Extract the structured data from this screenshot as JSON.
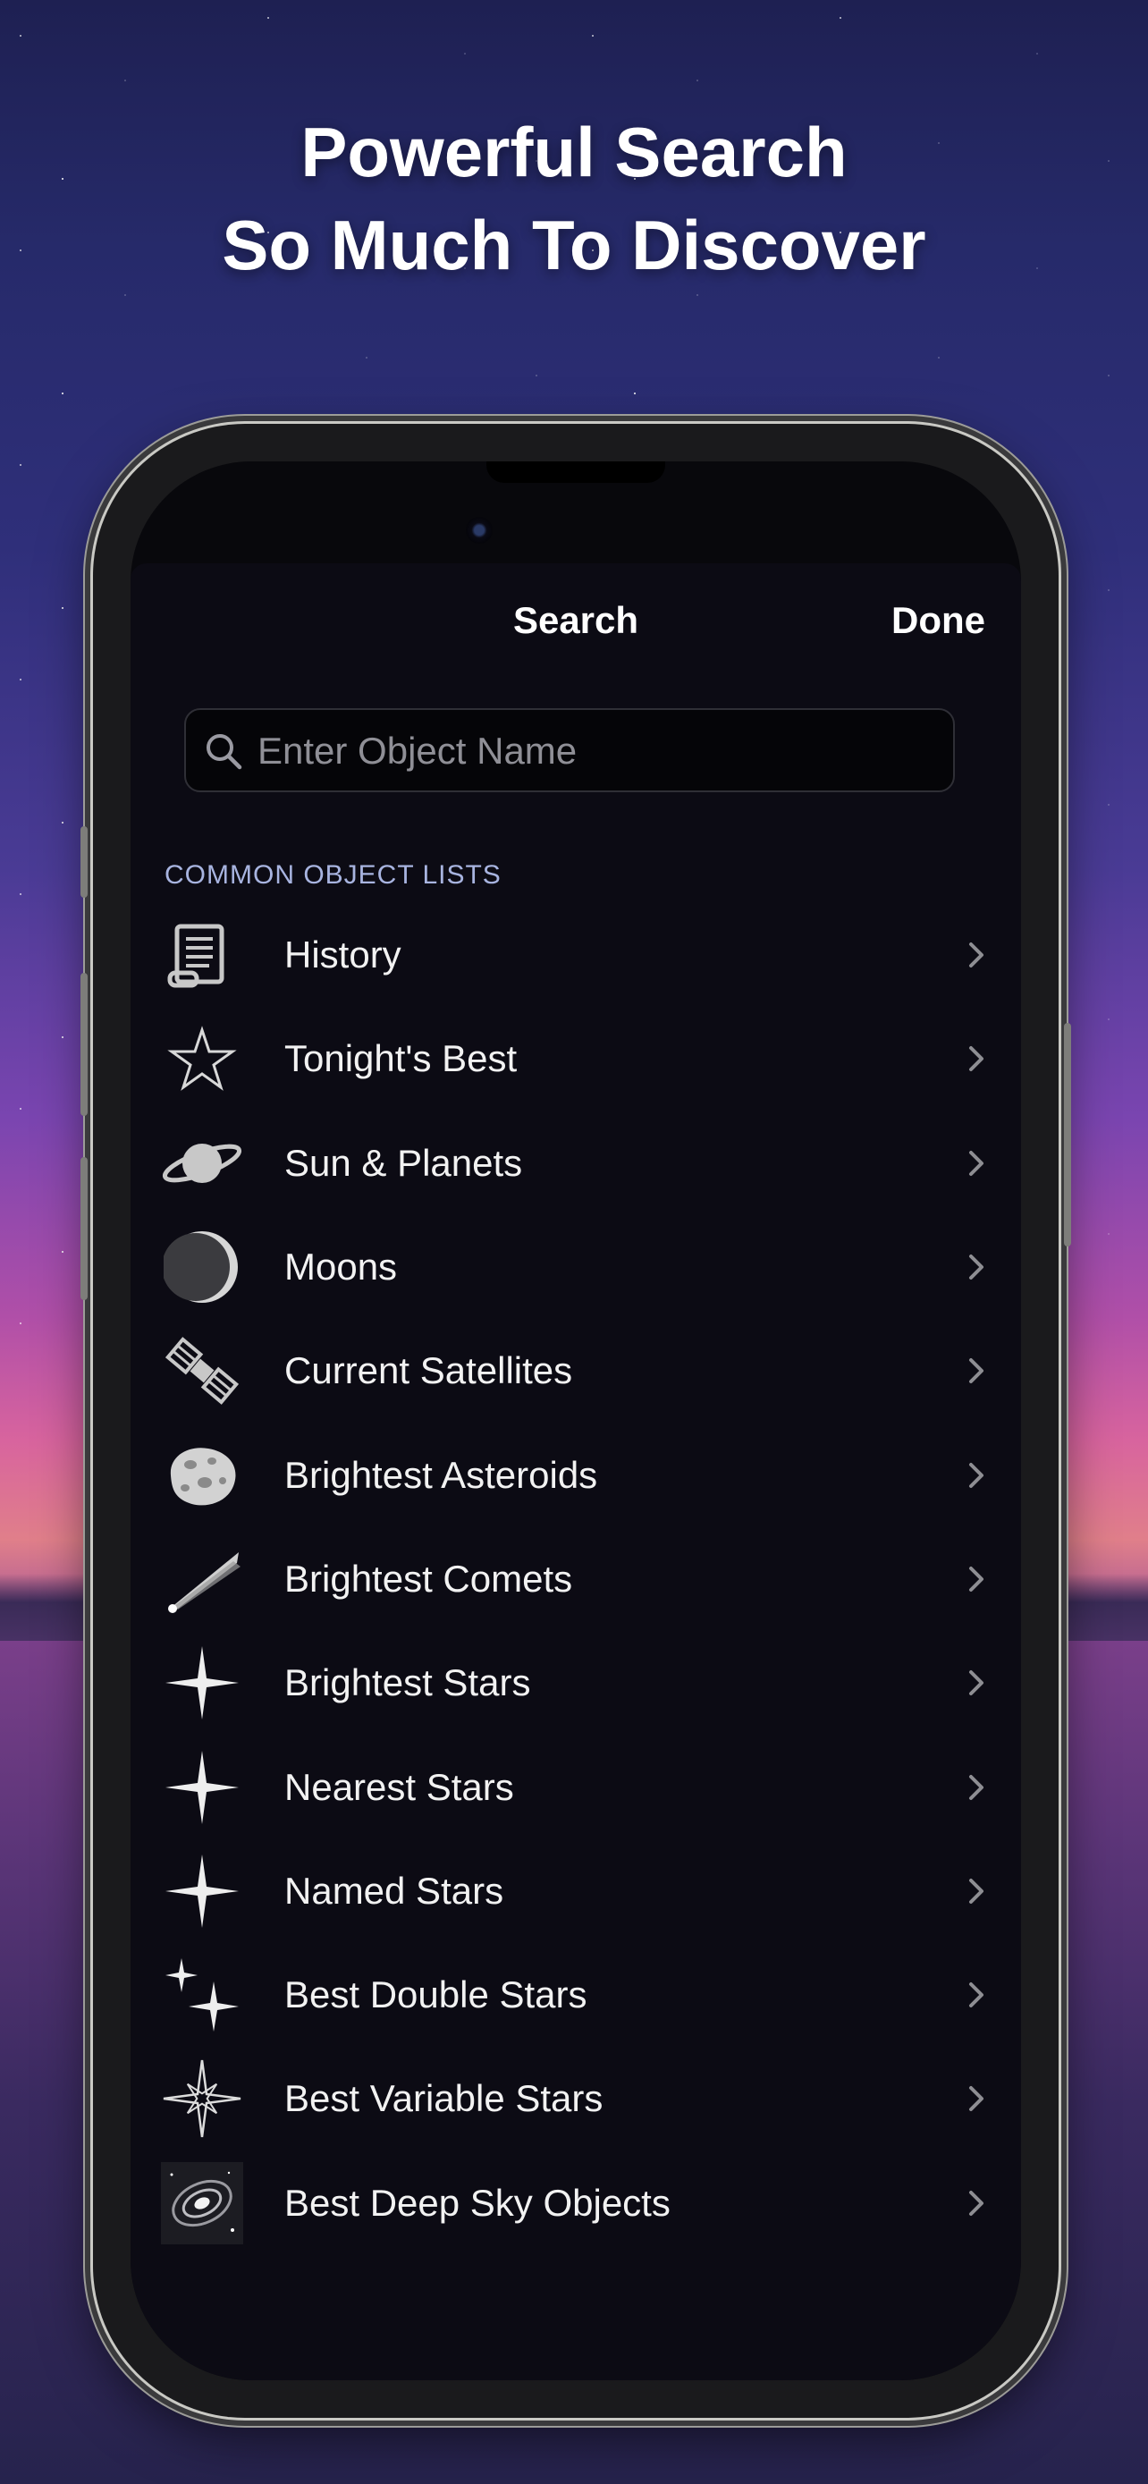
{
  "promo": {
    "line1": "Powerful Search",
    "line2": "So Much To Discover"
  },
  "nav": {
    "title": "Search",
    "done_label": "Done"
  },
  "search": {
    "placeholder": "Enter Object Name",
    "value": ""
  },
  "section": {
    "header": "COMMON OBJECT LISTS"
  },
  "list_items": [
    {
      "label": "History",
      "icon": "scroll-icon"
    },
    {
      "label": "Tonight's Best",
      "icon": "star-outline-icon"
    },
    {
      "label": "Sun & Planets",
      "icon": "planet-icon"
    },
    {
      "label": "Moons",
      "icon": "moon-icon"
    },
    {
      "label": "Current Satellites",
      "icon": "satellite-icon"
    },
    {
      "label": "Brightest Asteroids",
      "icon": "asteroid-icon"
    },
    {
      "label": "Brightest Comets",
      "icon": "comet-icon"
    },
    {
      "label": "Brightest Stars",
      "icon": "bright-star-icon"
    },
    {
      "label": "Nearest Stars",
      "icon": "near-star-icon"
    },
    {
      "label": "Named Stars",
      "icon": "named-star-icon"
    },
    {
      "label": "Best Double Stars",
      "icon": "double-star-icon"
    },
    {
      "label": "Best Variable Stars",
      "icon": "variable-star-icon"
    },
    {
      "label": "Best Deep Sky Objects",
      "icon": "galaxy-icon"
    }
  ],
  "colors": {
    "section_header": "#a8b4e0",
    "sheet_background": "#0c0b14",
    "chevron": "#8e8e93"
  }
}
